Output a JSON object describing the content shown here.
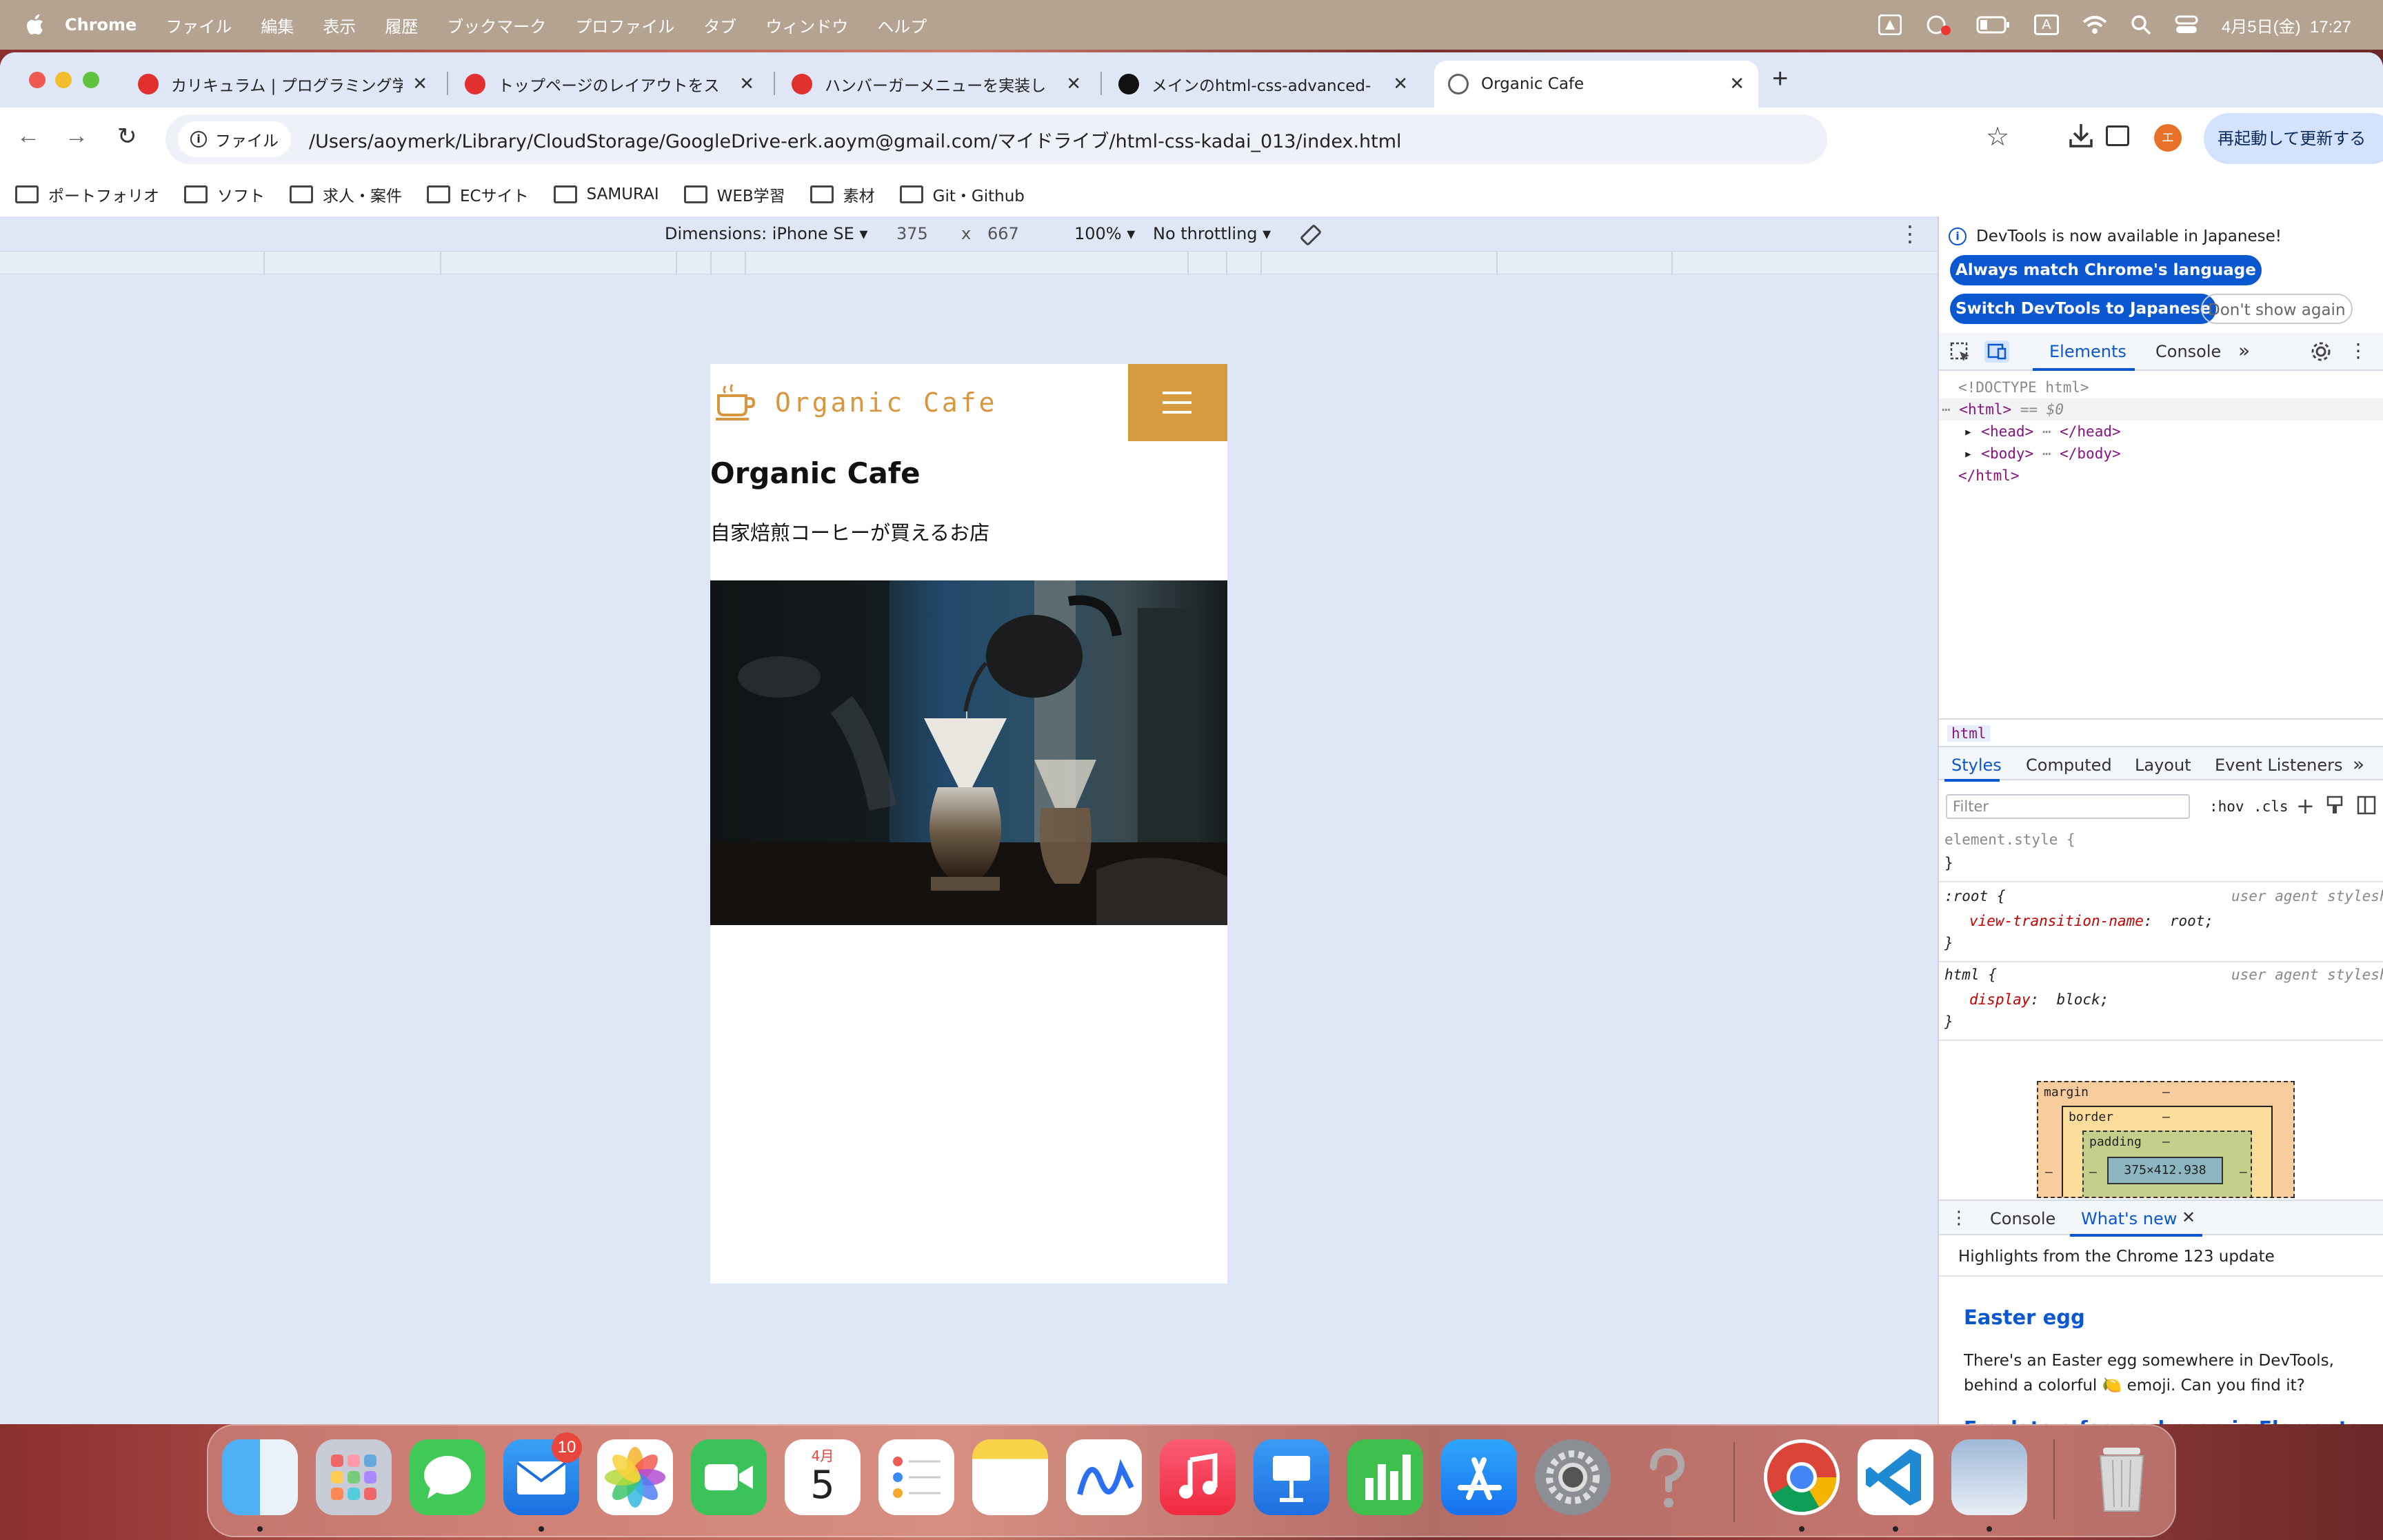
{
  "menubar": {
    "app": "Chrome",
    "items": [
      "ファイル",
      "編集",
      "表示",
      "履歴",
      "ブックマーク",
      "プロファイル",
      "タブ",
      "ウィンドウ",
      "ヘルプ"
    ],
    "input_mode": "A",
    "clock": "4月5日(金)  17:27"
  },
  "tabs": [
    {
      "title": "カリキュラム | プログラミング学",
      "favicon_color": "#e0312f"
    },
    {
      "title": "トップページのレイアウトをス",
      "favicon_color": "#e0312f"
    },
    {
      "title": "ハンバーガーメニューを実装し",
      "favicon_color": "#e0312f"
    },
    {
      "title": "メインのhtml-css-advanced-",
      "favicon_color": "#111111"
    },
    {
      "title": "Organic Cafe",
      "favicon_color": "#5f6368"
    }
  ],
  "new_tab": "+",
  "omnibox": {
    "chip": "ファイル",
    "url": "/Users/aoymerk/Library/CloudStorage/GoogleDrive-erk.aoym@gmail.com/マイドライブ/html-css-kadai_013/index.html"
  },
  "profile_initial": "エ",
  "relaunch_label": "再起動して更新する",
  "bookmarks": [
    "ポートフォリオ",
    "ソフト",
    "求人・案件",
    "ECサイト",
    "SAMURAI",
    "WEB学習",
    "素材",
    "Git・Github"
  ],
  "device_toolbar": {
    "dimensions": "Dimensions: iPhone SE",
    "width": "375",
    "times": "x",
    "height": "667",
    "zoom": "100%",
    "throttling": "No throttling"
  },
  "page": {
    "logo_text": "Organic Cafe",
    "title": "Organic Cafe",
    "subtitle": "自家焙煎コーヒーが買えるお店",
    "accent_color": "#d59b3e"
  },
  "devtools": {
    "notice": "DevTools is now available in Japanese!",
    "btn_match": "Always match Chrome's language",
    "btn_switch": "Switch DevTools to Japanese",
    "btn_dismiss": "Don't show again",
    "tabs": [
      "Elements",
      "Console"
    ],
    "dom": {
      "doctype": "<!DOCTYPE html>",
      "html_open": "<html>",
      "selected_marker": "== $0",
      "head": "<head>",
      "head_close": "</head>",
      "body": "<body>",
      "body_close": "</body>",
      "html_close": "</html>",
      "ellipsis": "⋯"
    },
    "breadcrumb": "html",
    "style_tabs": [
      "Styles",
      "Computed",
      "Layout",
      "Event Listeners"
    ],
    "filter_placeholder": "Filter",
    "hov": ":hov",
    "cls": ".cls",
    "rules": {
      "element_style": "element.style {",
      "close": "}",
      "root_selector": ":root {",
      "root_prop": "view-transition-name",
      "root_value": "root;",
      "html_selector": "html {",
      "html_prop": "display",
      "html_value": "block;",
      "ua": "user agent styleshee"
    },
    "boxmodel": {
      "margin": "margin",
      "border": "border",
      "padding": "padding",
      "dash": "–",
      "content": "375×412.938"
    },
    "drawer": {
      "tabs": [
        "Console",
        "What's new"
      ],
      "highlights": "Highlights from the Chrome 123 update",
      "h1": "Easter egg",
      "p1": "There's an Easter egg somewhere in DevTools, behind a colorful 🍋 emoji. Can you find it?",
      "h2": "Emulate a focused page in Elements > Styles"
    }
  },
  "dock": {
    "mail_badge": "10",
    "calendar_month": "4月",
    "calendar_day": "5"
  }
}
